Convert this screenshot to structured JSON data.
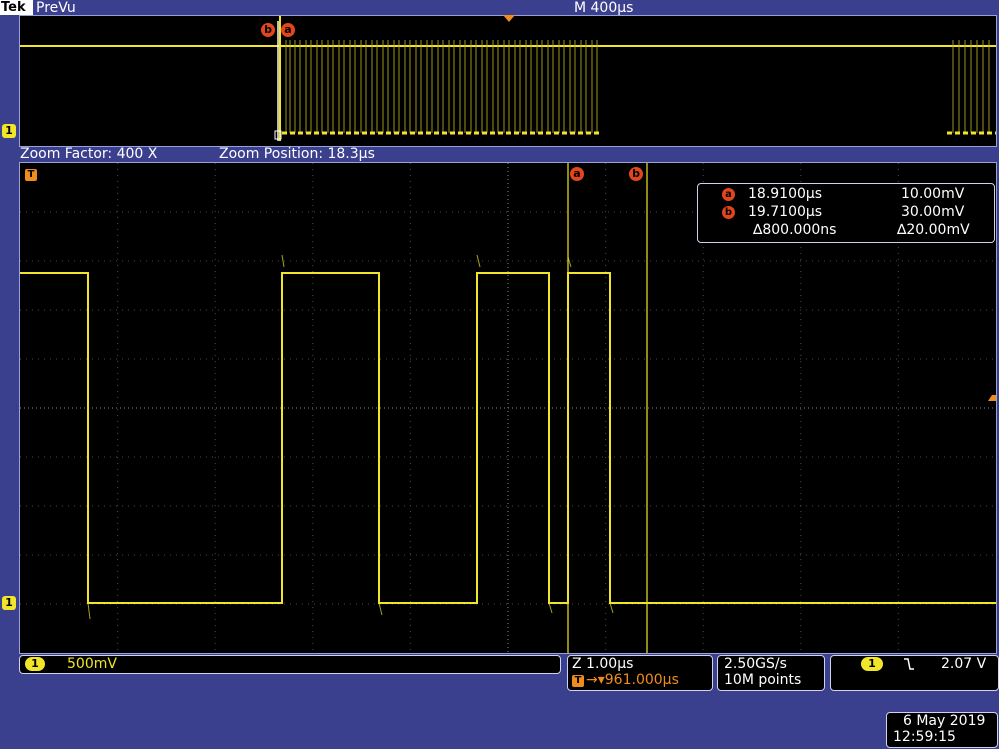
{
  "header": {
    "brand": "Tek",
    "mode": "PreVu",
    "timebase": "M 400µs"
  },
  "zoom_bar": {
    "factor": "Zoom Factor: 400 X",
    "position": "Zoom Position: 18.3µs"
  },
  "cursors": {
    "a_label": "a",
    "b_label": "b",
    "a_time": "18.9100µs",
    "a_volt": "10.00mV",
    "b_time": "19.7100µs",
    "b_volt": "30.00mV",
    "delta_time": "∆800.000ns",
    "delta_volt": "∆20.00mV"
  },
  "markers": {
    "channel": "1",
    "trigger": "T"
  },
  "status": {
    "ch1_scale": "500mV",
    "zoom_scale": "Z 1.00µs",
    "trigger_offset": "961.000µs",
    "sample_rate": "2.50GS/s",
    "record_length": "10M points",
    "trigger_channel": "1",
    "trigger_slope_icon": "falling-edge-icon",
    "trigger_level": "2.07 V"
  },
  "datetime": {
    "date": "6 May 2019",
    "time": "12:59:15"
  },
  "colors": {
    "trace": "#f0e52a",
    "cursor_marker": "#e3461b",
    "trigger": "#f08c1e",
    "frame": "#3a3f8e"
  }
}
